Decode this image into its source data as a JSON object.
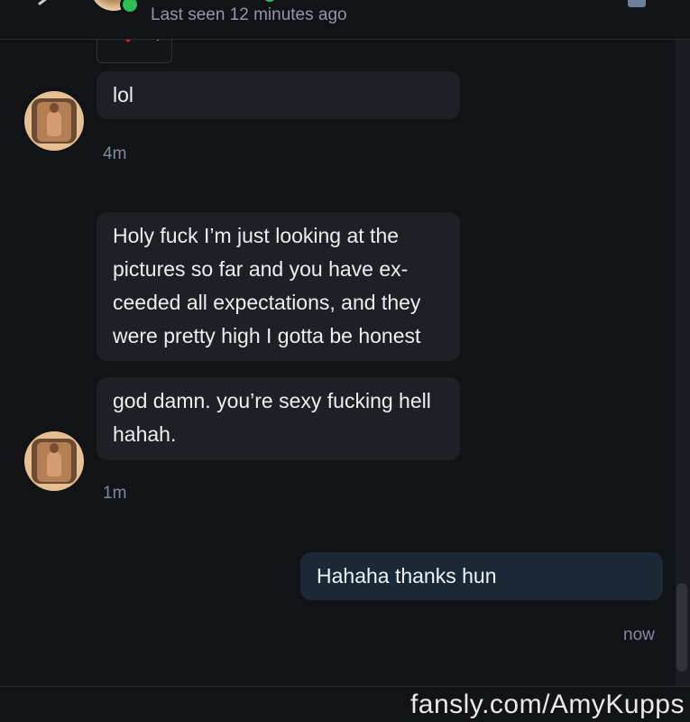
{
  "header": {
    "last_seen": "Last seen 12 minutes ago"
  },
  "colors": {
    "background": "#121316",
    "incoming_bubble": "#1e2026",
    "outgoing_bubble": "#1b2838",
    "timestamp": "#7e89a3",
    "online": "#2fbf5a",
    "heart": "#e0202b"
  },
  "messages": [
    {
      "sender": "them",
      "text": "lol",
      "time": "4m"
    },
    {
      "sender": "them",
      "text_lines": [
        "Holy fuck I’m just looking at the",
        "pictures so far and you have ex-",
        "ceeded all expectations, and they",
        "were pretty high I gotta be honest"
      ]
    },
    {
      "sender": "them",
      "text_lines": [
        "god damn. you’re sexy fucking hell",
        "hahah."
      ],
      "time": "1m"
    },
    {
      "sender": "me",
      "text": "Hahaha thanks hun",
      "time": "now"
    }
  ],
  "watermark": "fansly.com/AmyKupps"
}
